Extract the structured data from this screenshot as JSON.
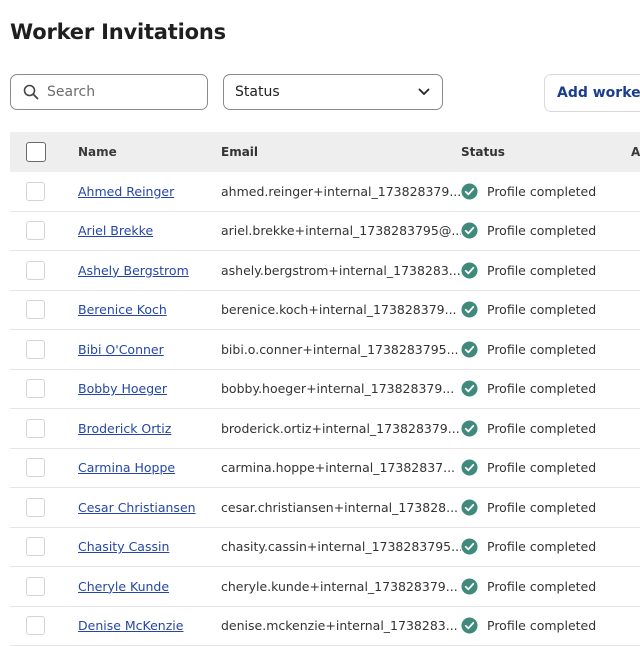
{
  "page_title": "Worker Invitations",
  "search": {
    "placeholder": "Search",
    "value": ""
  },
  "status_filter": {
    "label": "Status"
  },
  "add_button": {
    "label": "Add worker"
  },
  "colors": {
    "link": "#2446a6",
    "status_ok": "#3f8a7d",
    "button_text": "#1b3e8c",
    "header_bg": "#eeeeee"
  },
  "table": {
    "columns": {
      "name": "Name",
      "email": "Email",
      "status": "Status",
      "extra": "A"
    },
    "rows": [
      {
        "name": "Ahmed Reinger",
        "email": "ahmed.reinger+internal_173828379...",
        "status": "Profile completed"
      },
      {
        "name": "Ariel Brekke",
        "email": "ariel.brekke+internal_1738283795@...",
        "status": "Profile completed"
      },
      {
        "name": "Ashely Bergstrom",
        "email": "ashely.bergstrom+internal_1738283...",
        "status": "Profile completed"
      },
      {
        "name": "Berenice Koch",
        "email": "berenice.koch+internal_173828379...",
        "status": "Profile completed"
      },
      {
        "name": "Bibi O'Conner",
        "email": "bibi.o.conner+internal_1738283795...",
        "status": "Profile completed"
      },
      {
        "name": "Bobby Hoeger",
        "email": "bobby.hoeger+internal_173828379...",
        "status": "Profile completed"
      },
      {
        "name": "Broderick Ortiz",
        "email": "broderick.ortiz+internal_173828379...",
        "status": "Profile completed"
      },
      {
        "name": "Carmina Hoppe",
        "email": "carmina.hoppe+internal_17382837...",
        "status": "Profile completed"
      },
      {
        "name": "Cesar Christiansen",
        "email": "cesar.christiansen+internal_173828...",
        "status": "Profile completed"
      },
      {
        "name": "Chasity Cassin",
        "email": "chasity.cassin+internal_1738283795...",
        "status": "Profile completed"
      },
      {
        "name": "Cheryle Kunde",
        "email": "cheryle.kunde+internal_173828379...",
        "status": "Profile completed"
      },
      {
        "name": "Denise McKenzie",
        "email": "denise.mckenzie+internal_1738283...",
        "status": "Profile completed"
      }
    ]
  }
}
